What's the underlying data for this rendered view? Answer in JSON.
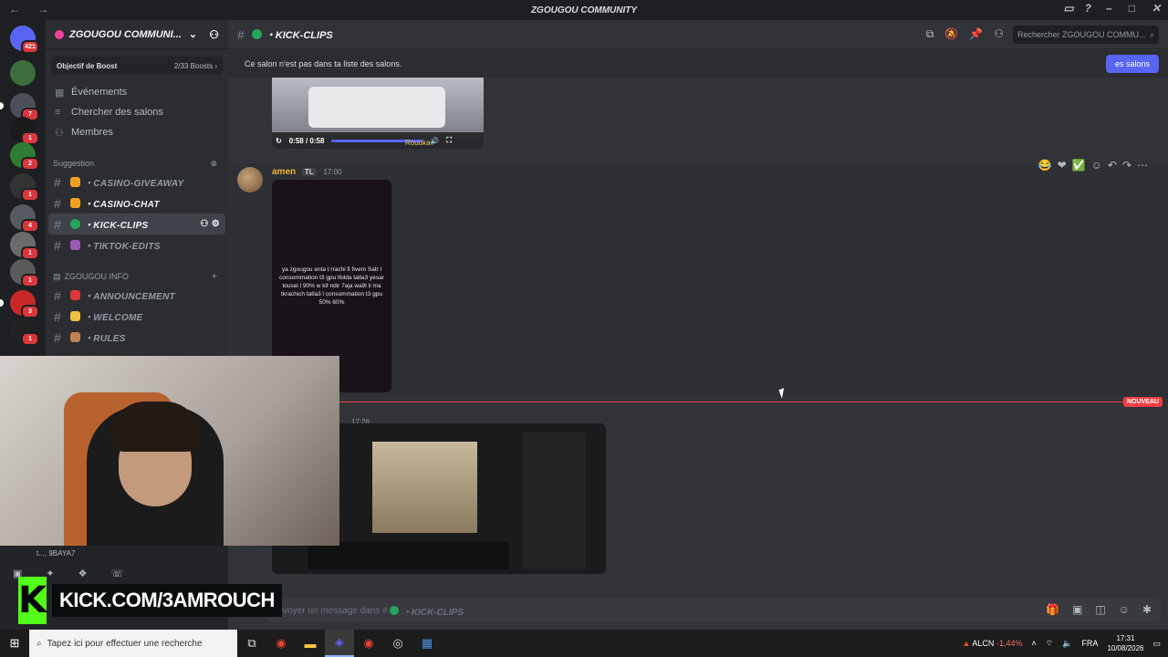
{
  "window": {
    "title": "ZGOUGOU COMMUNITY"
  },
  "servers": {
    "mentions_badge": "421",
    "items": [
      {
        "badge": "7"
      },
      {
        "badge": "1"
      },
      {
        "badge": "2"
      },
      {
        "badge": "1"
      },
      {
        "badge": "4"
      },
      {
        "badge": "1"
      },
      {
        "badge": "1"
      },
      {
        "badge": "3"
      },
      {
        "badge": "1"
      }
    ]
  },
  "sidebar": {
    "server_name": "ZGOUGOU COMMUNI...",
    "boost_label": "Objectif de Boost",
    "boost_count": "2/33 Boosts",
    "nav": [
      {
        "label": "Événements",
        "icon": "calendar-icon"
      },
      {
        "label": "Chercher des salons",
        "icon": "browse-icon"
      },
      {
        "label": "Membres",
        "icon": "members-icon"
      }
    ],
    "suggestion_category": "Suggestion",
    "suggested_channels": [
      {
        "label": "・CASINO-GIVEAWAY",
        "emoji_color": "#f0a020"
      },
      {
        "label": "・CASINO-CHAT",
        "emoji_color": "#f0a020"
      },
      {
        "label": "・KICK-CLIPS",
        "emoji_color": "#23a55a"
      },
      {
        "label": "・TIKTOK-EDITS",
        "emoji_color": "#9b59b6"
      }
    ],
    "info_category": "ZGOUGOU INFO",
    "info_channels": [
      {
        "label": "・ANNOUNCEMENT",
        "emoji_color": "#da373c"
      },
      {
        "label": "・WELCOME",
        "emoji_color": "#f0c040"
      },
      {
        "label": "・RULES",
        "emoji_color": "#c08050"
      }
    ],
    "user_status": "t..., 9BAYA7"
  },
  "header": {
    "channel_name": "KICK-CLIPS",
    "search_placeholder": "Rechercher ZGOUGOU COMMU..."
  },
  "notice": {
    "text": "Ce salon n'est pas dans ta liste des salons.",
    "button": "es salons"
  },
  "messages": {
    "video_time": "0:58 / 0:58",
    "video_watermark": "Rouuka",
    "m1": {
      "author": "amen",
      "role_tag": "TL",
      "time": "17:00",
      "clip_text": "ya zgougou enta t rrachi fi fivem Satr l consommation t3 gpu lfolda tatla3 yesar tousel l 90% w kif ndir 7aja wa9t li ma tkrachich tatla3 l consommation t3 gpu 50% 60%"
    },
    "divider_label": "NOUVEAU",
    "m2": {
      "time": "17:26"
    }
  },
  "composer": {
    "placeholder": "Envoyer un message dans #",
    "channel": "KICK-CLIPS"
  },
  "overlay": {
    "kick_prefix": "KICK.COM/",
    "kick_handle": "3AMROUCH"
  },
  "taskbar": {
    "search_placeholder": "Tapez ici pour effectuer une recherche",
    "ticker": "ALCN",
    "ticker_change": "-1,44%",
    "lang": "FRA",
    "time": "17:31",
    "date": "10/08/2026"
  },
  "colors": {
    "brand": "#5865f2",
    "kick_green": "#53fc18",
    "danger": "#f23f43"
  }
}
